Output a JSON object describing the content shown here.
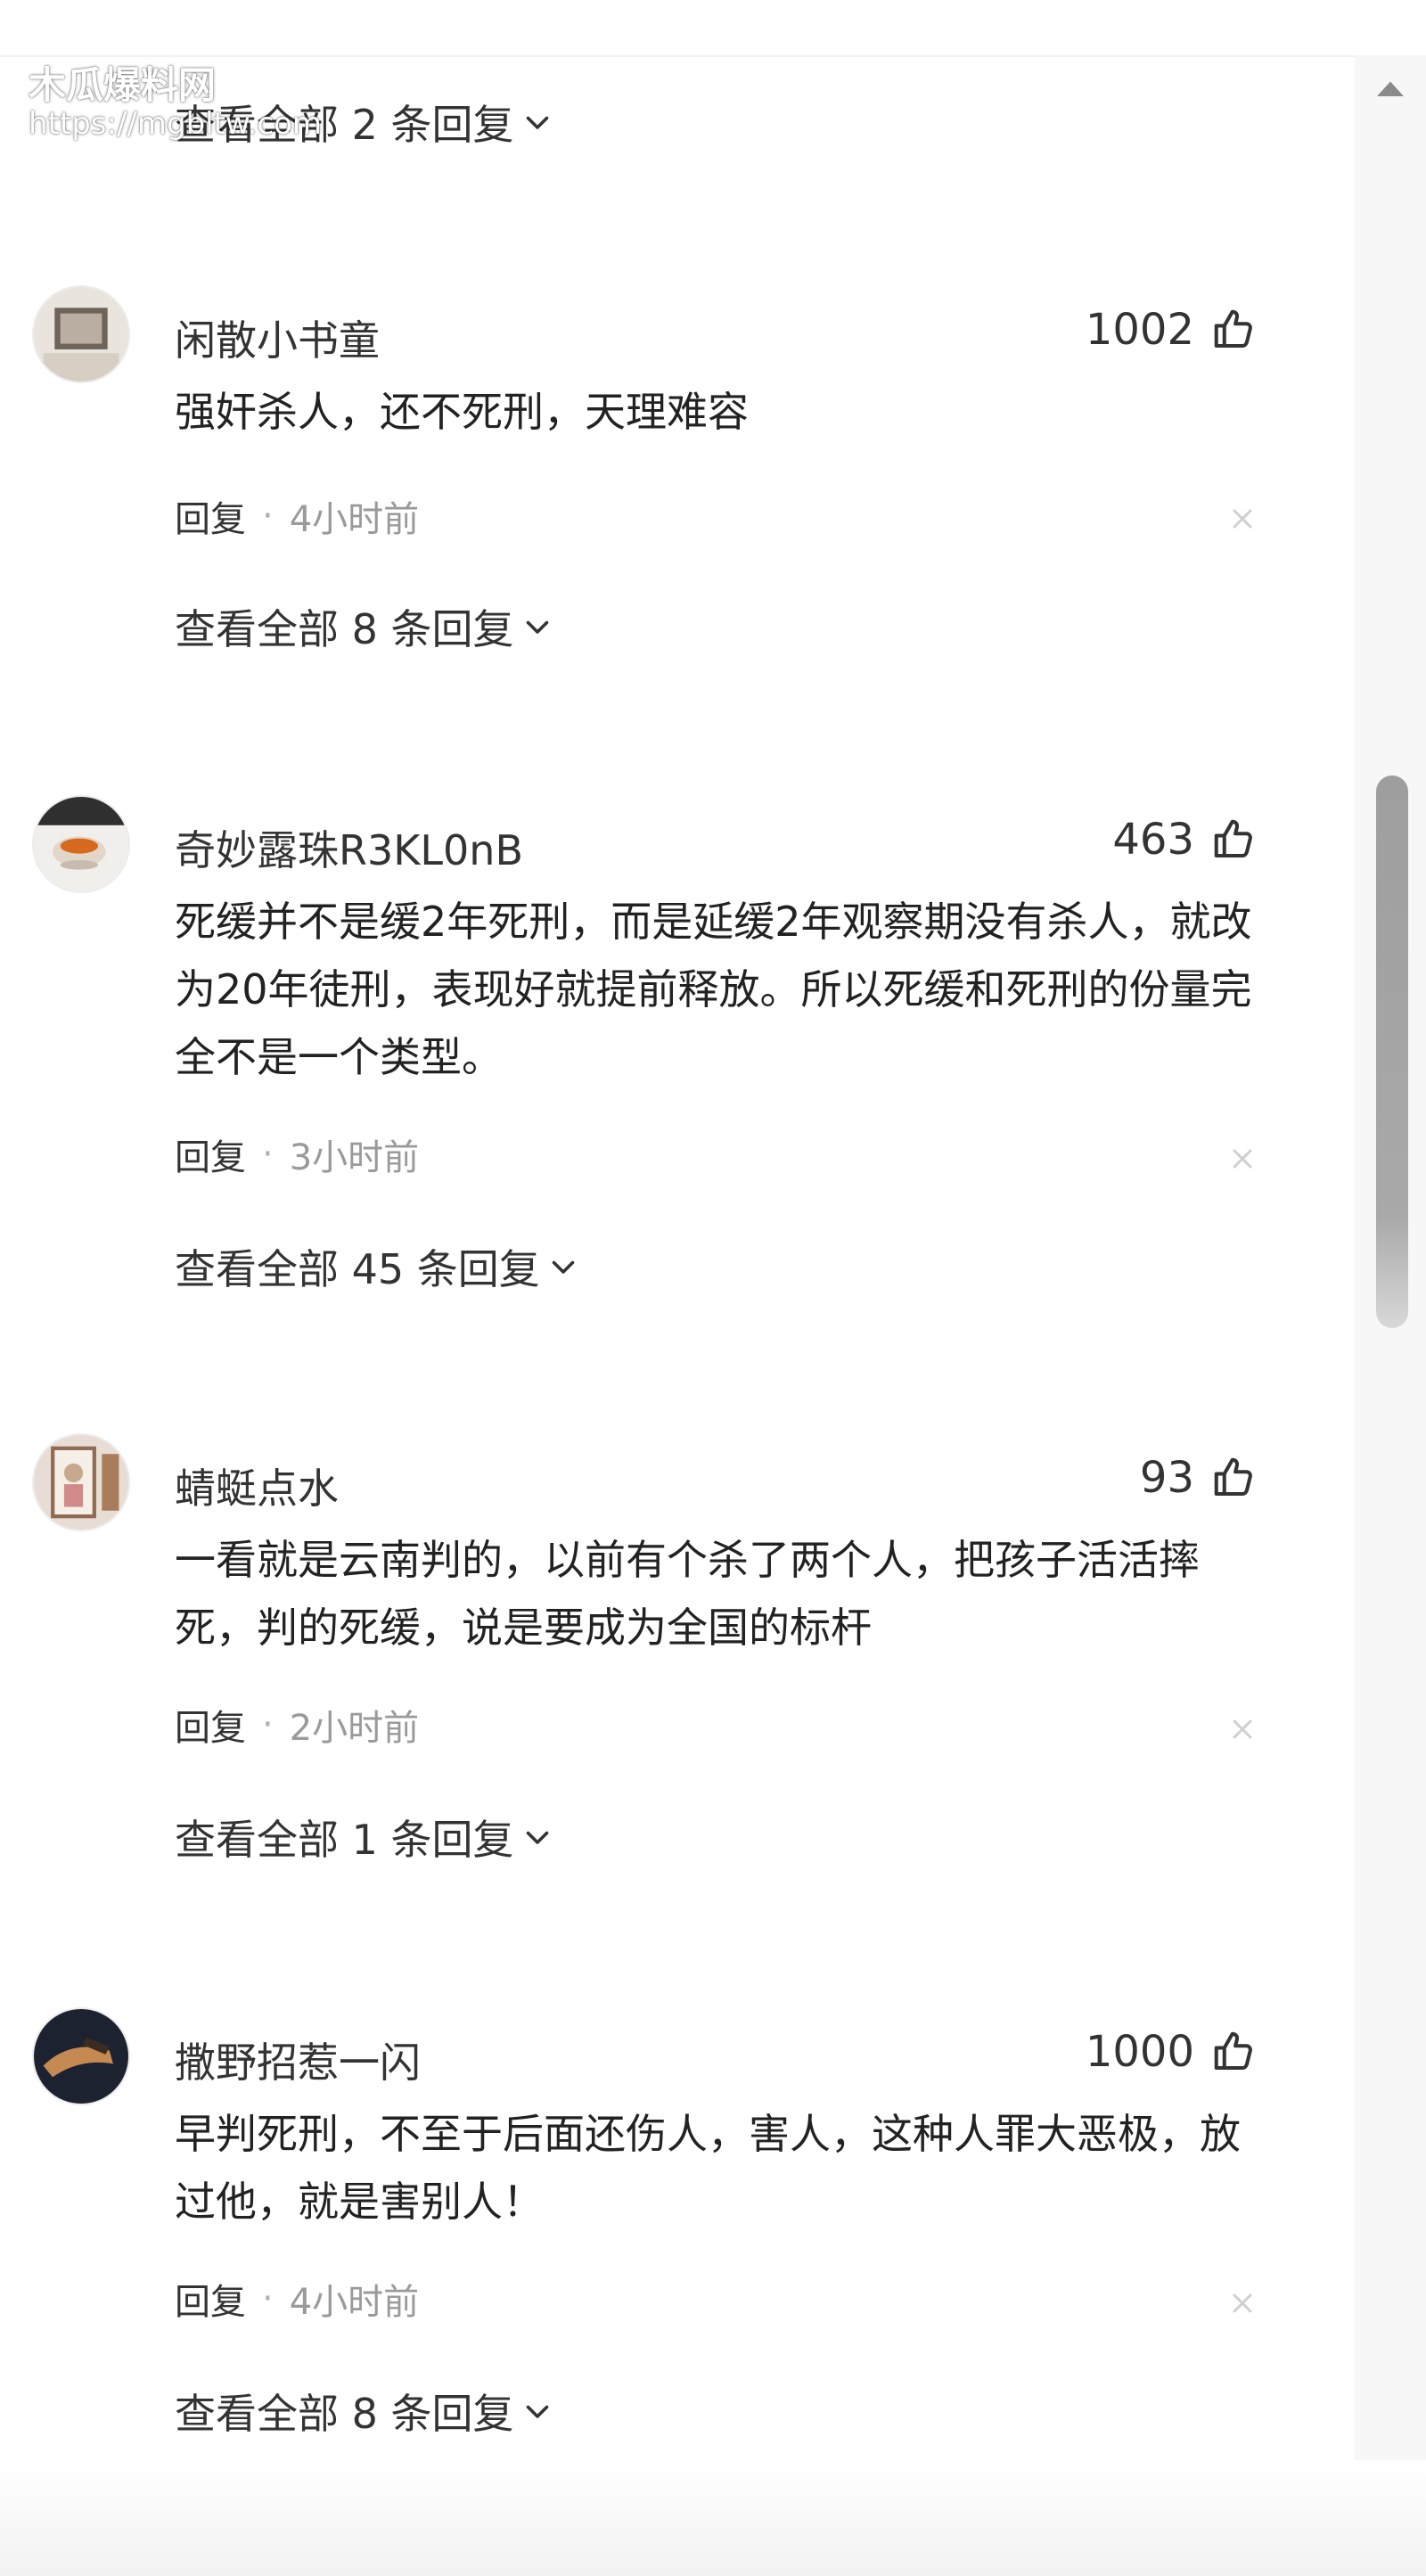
{
  "watermark": {
    "title": "木瓜爆料网",
    "url": "https://mgbltw.com"
  },
  "top_replies_link": "查看全部 2 条回复",
  "comments": [
    {
      "username": "闲散小书童",
      "likes": "1002",
      "content": "强奸杀人，还不死刑，天理难容",
      "reply_label": "回复",
      "separator": "·",
      "time": "4小时前",
      "view_replies": "查看全部 8 条回复",
      "avatar_icon": "photo-frame-avatar-icon"
    },
    {
      "username": "奇妙露珠R3KL0nB",
      "likes": "463",
      "content": "死缓并不是缓2年死刑，而是延缓2年观察期没有杀人，就改为20年徒刑，表现好就提前释放。所以死缓和死刑的份量完全不是一个类型。",
      "reply_label": "回复",
      "separator": "·",
      "time": "3小时前",
      "view_replies": "查看全部 45 条回复",
      "avatar_icon": "tea-cup-avatar-icon"
    },
    {
      "username": "蜻蜓点水",
      "likes": "93",
      "content": "一看就是云南判的，以前有个杀了两个人，把孩子活活摔死，判的死缓，说是要成为全国的标杆",
      "reply_label": "回复",
      "separator": "·",
      "time": "2小时前",
      "view_replies": "查看全部 1 条回复",
      "avatar_icon": "portrait-avatar-icon"
    },
    {
      "username": "撒野招惹一闪",
      "likes": "1000",
      "content": "早判死刑，不至于后面还伤人，害人，这种人罪大恶极，放过他，就是害别人！",
      "reply_label": "回复",
      "separator": "·",
      "time": "4小时前",
      "view_replies": "查看全部 8 条回复",
      "avatar_icon": "dark-hand-avatar-icon"
    }
  ],
  "icons": {
    "like": "thumbs-up-icon",
    "dismiss": "close-icon",
    "expand": "chevron-down-icon",
    "scroll_up": "caret-up-icon"
  },
  "colors": {
    "text_primary": "#222222",
    "text_secondary": "#8c8c8c",
    "scrollbar": "#a3a3a3"
  }
}
